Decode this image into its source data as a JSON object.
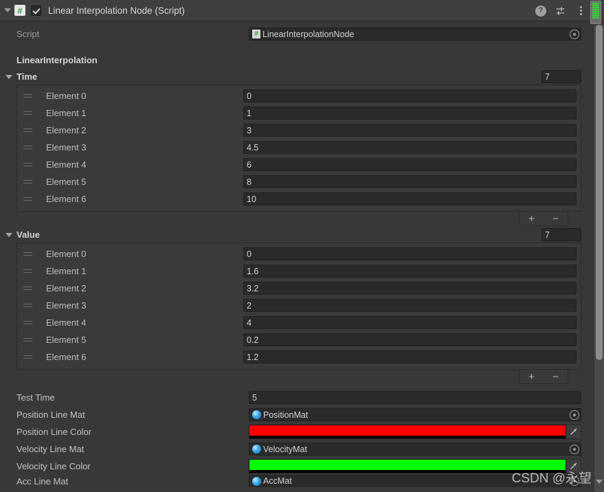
{
  "component": {
    "title": "Linear Interpolation Node (Script)",
    "enabled_checkbox": true,
    "icon": "csharp-script-icon",
    "header_icons": [
      "help-icon",
      "preset-icon",
      "more-menu-icon"
    ]
  },
  "script_row": {
    "label": "Script",
    "value": "LinearInterpolationNode",
    "icon": "script-asset-icon",
    "selector": "object-picker-icon"
  },
  "section": {
    "title": "LinearInterpolation"
  },
  "arrays": [
    {
      "name": "Time",
      "size": "7",
      "element_label_prefix": "Element",
      "elements": [
        {
          "label": "Element 0",
          "value": "0"
        },
        {
          "label": "Element 1",
          "value": "1"
        },
        {
          "label": "Element 2",
          "value": "3"
        },
        {
          "label": "Element 3",
          "value": "4.5"
        },
        {
          "label": "Element 4",
          "value": "6"
        },
        {
          "label": "Element 5",
          "value": "8"
        },
        {
          "label": "Element 6",
          "value": "10"
        }
      ],
      "add_label": "+",
      "remove_label": "−"
    },
    {
      "name": "Value",
      "size": "7",
      "element_label_prefix": "Element",
      "elements": [
        {
          "label": "Element 0",
          "value": "0"
        },
        {
          "label": "Element 1",
          "value": "1.6"
        },
        {
          "label": "Element 2",
          "value": "3.2"
        },
        {
          "label": "Element 3",
          "value": "2"
        },
        {
          "label": "Element 4",
          "value": "4"
        },
        {
          "label": "Element 5",
          "value": "0.2"
        },
        {
          "label": "Element 6",
          "value": "1.2"
        }
      ],
      "add_label": "+",
      "remove_label": "−"
    }
  ],
  "properties": {
    "test_time": {
      "label": "Test Time",
      "value": "5"
    },
    "position_line_mat": {
      "label": "Position Line Mat",
      "value": "PositionMat"
    },
    "position_line_color": {
      "label": "Position Line Color",
      "color": "#FF0000",
      "alpha_color": "#000000"
    },
    "velocity_line_mat": {
      "label": "Velocity Line Mat",
      "value": "VelocityMat"
    },
    "velocity_line_color": {
      "label": "Velocity Line Color",
      "color": "#00FF00",
      "alpha_color": "#000000"
    },
    "acc_line_mat": {
      "label": "Acc Line Mat",
      "value": "AccMat"
    }
  },
  "watermark": {
    "text": "CSDN @永望"
  },
  "colors": {
    "panel_bg": "#383838",
    "header_bg": "#3f3f3f",
    "field_bg": "#2a2a2a",
    "box_bg": "#3a3a3a",
    "text": "#c4c4c4",
    "scrollbar_thumb": "#8c8c8c",
    "indicator_green": "#2ee02e"
  }
}
